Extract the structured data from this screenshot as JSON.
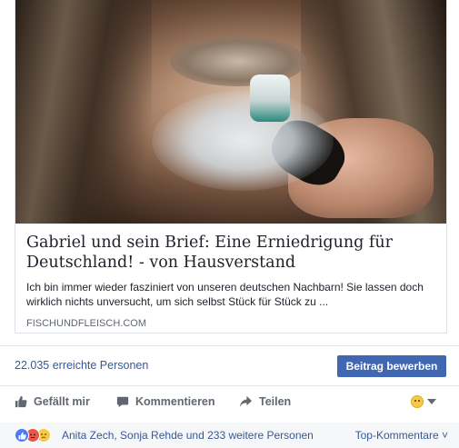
{
  "link_preview": {
    "title": "Gabriel und sein Brief: Eine Erniedrigung für Deutschland! - von Hausverstand",
    "description": "Ich bin immer wieder fasziniert von unseren deutschen Nachbarn! Sie lassen doch wirklich nichts unversucht, um sich selbst Stück für Stück zu ...",
    "domain": "FISCHUNDFLEISCH.COM"
  },
  "reach": {
    "text": "22.035 erreichte Personen",
    "boost_label": "Beitrag bewerben"
  },
  "actions": {
    "like_label": "Gefällt mir",
    "comment_label": "Kommentieren",
    "share_label": "Teilen"
  },
  "reactions": {
    "icons": [
      "like-icon",
      "angry-icon",
      "sad-icon"
    ],
    "summary": "Anita Zech, Sonja Rehde und 233 weitere Personen",
    "sort_label": "Top-Kommentare ˅"
  },
  "colors": {
    "link_blue": "#365899",
    "button_blue": "#4267b2",
    "action_gray": "#606770"
  }
}
